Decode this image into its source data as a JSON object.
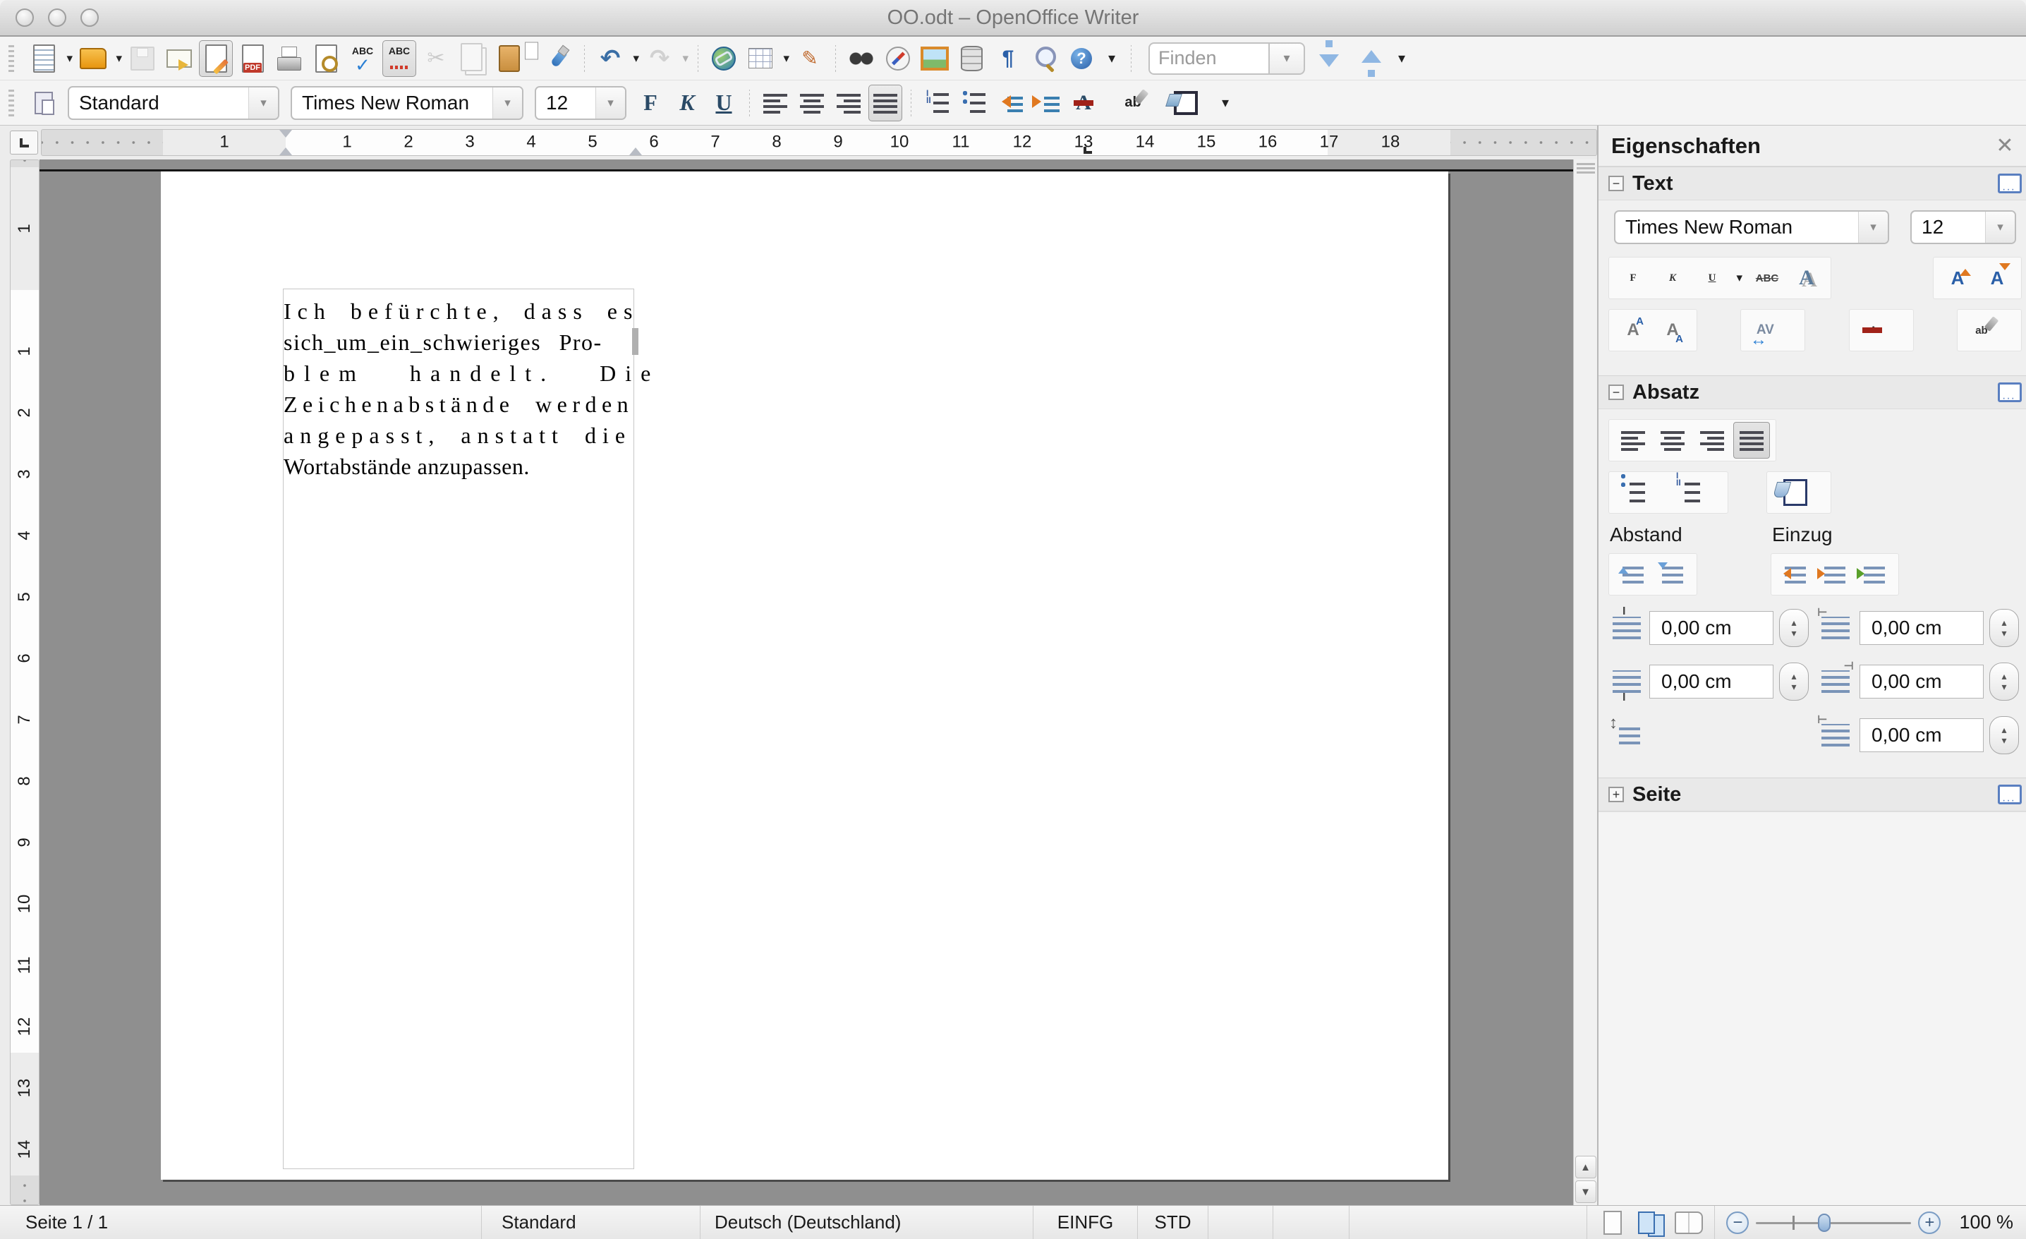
{
  "window": {
    "title": "OO.odt – OpenOffice Writer"
  },
  "toolbar_main": {
    "find_placeholder": "Finden",
    "items": [
      {
        "name": "toolbar-grip",
        "cls": "tb-grip",
        "inter": "true"
      },
      {
        "name": "new-document-icon",
        "cls": "tbtn i-new dd",
        "inter": "true"
      },
      {
        "name": "open-icon",
        "cls": "tbtn i-open dd",
        "inter": "true"
      },
      {
        "name": "save-icon",
        "cls": "tbtn i-save",
        "state": "disabled",
        "inter": "true"
      },
      {
        "name": "email-icon",
        "cls": "tbtn i-mail",
        "inter": "true"
      },
      {
        "name": "edit-file-icon",
        "cls": "tbtn i-edit",
        "state": "active",
        "inter": "true"
      },
      {
        "name": "export-pdf-icon",
        "cls": "tbtn i-pdf",
        "inter": "true"
      },
      {
        "name": "print-icon",
        "cls": "tbtn i-print",
        "inter": "true"
      },
      {
        "name": "page-preview-icon",
        "cls": "tbtn i-preview",
        "inter": "true"
      },
      {
        "name": "spellcheck-icon",
        "cls": "tbtn i-spell",
        "glyph": "ABC",
        "inter": "true"
      },
      {
        "name": "auto-spellcheck-icon",
        "cls": "tbtn i-autospell",
        "glyph": "ABC",
        "state": "active",
        "inter": "true"
      },
      {
        "name": "cut-icon",
        "cls": "tbtn i-cut",
        "glyph": "✂",
        "state": "disabled",
        "inter": "true"
      },
      {
        "name": "copy-icon",
        "cls": "tbtn i-copy",
        "state": "disabled",
        "inter": "true"
      },
      {
        "name": "paste-icon",
        "cls": "tbtn i-paste dd",
        "inter": "true"
      },
      {
        "name": "format-paintbrush-icon",
        "cls": "tbtn i-brush",
        "inter": "true"
      },
      {
        "name": "separator",
        "cls": "tb-sep",
        "inter": "false"
      },
      {
        "name": "undo-icon",
        "cls": "tbtn i-undo dd",
        "glyph": "↶",
        "inter": "true"
      },
      {
        "name": "redo-icon",
        "cls": "tbtn i-redo dd",
        "glyph": "↷",
        "state": "disabled",
        "inter": "true"
      },
      {
        "name": "separator",
        "cls": "tb-sep",
        "inter": "false"
      },
      {
        "name": "hyperlink-icon",
        "cls": "tbtn i-link",
        "inter": "true"
      },
      {
        "name": "insert-table-icon",
        "cls": "tbtn i-table dd",
        "inter": "true"
      },
      {
        "name": "draw-functions-icon",
        "cls": "tbtn i-draw",
        "glyph": "✎",
        "inter": "true"
      },
      {
        "name": "separator",
        "cls": "tb-sep",
        "inter": "false"
      },
      {
        "name": "find-replace-icon",
        "cls": "tbtn i-find",
        "inter": "true"
      },
      {
        "name": "navigator-icon",
        "cls": "tbtn i-nav",
        "inter": "true"
      },
      {
        "name": "gallery-icon",
        "cls": "tbtn i-gallery",
        "inter": "true"
      },
      {
        "name": "data-sources-icon",
        "cls": "tbtn i-data",
        "inter": "true"
      },
      {
        "name": "nonprinting-characters-icon",
        "cls": "tbtn i-pilcrow",
        "glyph": "¶",
        "inter": "true"
      },
      {
        "name": "zoom-icon",
        "cls": "tbtn i-zoom",
        "inter": "true"
      },
      {
        "name": "help-icon",
        "cls": "tbtn i-help",
        "glyph": "?",
        "inter": "true"
      },
      {
        "name": "toolbar-overflow-icon",
        "cls": "tbtn i-ovf",
        "glyph": "▾",
        "inter": "true"
      }
    ]
  },
  "toolbar_format": {
    "style_value": "Standard",
    "font_value": "Times New Roman",
    "size_value": "12",
    "dd_glyph": "▾",
    "items": [
      {
        "name": "bold-icon",
        "cls": "tbtn i-bold",
        "glyph": "F",
        "inter": "true"
      },
      {
        "name": "italic-icon",
        "cls": "tbtn i-italic",
        "glyph": "K",
        "inter": "true"
      },
      {
        "name": "underline-icon",
        "cls": "tbtn i-underline",
        "glyph": "U",
        "inter": "true"
      },
      {
        "name": "separator",
        "cls": "tb-sep",
        "inter": "false"
      },
      {
        "name": "align-left-icon",
        "cls": "tbtn al al-l",
        "inter": "true"
      },
      {
        "name": "align-center-icon",
        "cls": "tbtn al al-c",
        "inter": "true"
      },
      {
        "name": "align-right-icon",
        "cls": "tbtn al al-r",
        "inter": "true"
      },
      {
        "name": "align-justify-icon",
        "cls": "tbtn al al-j",
        "state": "active",
        "inter": "true"
      },
      {
        "name": "separator",
        "cls": "tb-sep",
        "inter": "false"
      },
      {
        "name": "numbered-list-icon",
        "cls": "tbtn i-listnum",
        "inter": "true"
      },
      {
        "name": "bullet-list-icon",
        "cls": "tbtn i-listbul",
        "inter": "true"
      },
      {
        "name": "decrease-indent-icon",
        "cls": "tbtn i-outdent",
        "inter": "true"
      },
      {
        "name": "increase-indent-icon",
        "cls": "tbtn i-indent",
        "inter": "true"
      },
      {
        "name": "font-color-icon",
        "cls": "tbtn i-fontcolor dd",
        "glyph": "A",
        "inter": "true"
      },
      {
        "name": "highlighting-icon",
        "cls": "tbtn i-highlight dd",
        "glyph": "ab",
        "inter": "true"
      },
      {
        "name": "background-color-icon",
        "cls": "tbtn i-bgcolor dd",
        "inter": "true"
      },
      {
        "name": "toolbar-overflow-icon",
        "cls": "tbtn i-ovf",
        "glyph": "▾",
        "inter": "true"
      }
    ]
  },
  "ruler": {
    "h_numbers": [
      {
        "n": "1",
        "style": "left:259px",
        "inter": "false"
      },
      {
        "n": "1",
        "style": "left:433px",
        "inter": "false"
      },
      {
        "n": "2",
        "style": "left:520px",
        "inter": "false"
      },
      {
        "n": "3",
        "style": "left:607px",
        "inter": "false"
      },
      {
        "n": "4",
        "style": "left:694px",
        "inter": "false"
      },
      {
        "n": "5",
        "style": "left:781px",
        "inter": "false"
      },
      {
        "n": "6",
        "style": "left:868px",
        "inter": "false"
      },
      {
        "n": "7",
        "style": "left:955px",
        "inter": "false"
      },
      {
        "n": "8",
        "style": "left:1042px",
        "inter": "false"
      },
      {
        "n": "9",
        "style": "left:1129px",
        "inter": "false"
      },
      {
        "n": "10",
        "style": "left:1216px",
        "inter": "false"
      },
      {
        "n": "11",
        "style": "left:1303px",
        "inter": "false"
      },
      {
        "n": "12",
        "style": "left:1390px",
        "inter": "false"
      },
      {
        "n": "13",
        "style": "left:1477px",
        "inter": "false"
      },
      {
        "n": "14",
        "style": "left:1564px",
        "inter": "false"
      },
      {
        "n": "15",
        "style": "left:1651px",
        "inter": "false"
      },
      {
        "n": "16",
        "style": "left:1738px",
        "inter": "false"
      },
      {
        "n": "17",
        "style": "left:1825px",
        "inter": "false"
      },
      {
        "n": "18",
        "style": "left:1912px",
        "inter": "false"
      }
    ],
    "v_numbers": [
      {
        "n": "1",
        "style": "top:97px",
        "inter": "false"
      },
      {
        "n": "1",
        "style": "top:271px",
        "inter": "false"
      },
      {
        "n": "2",
        "style": "top:358px",
        "inter": "false"
      },
      {
        "n": "3",
        "style": "top:445px",
        "inter": "false"
      },
      {
        "n": "4",
        "style": "top:532px",
        "inter": "false"
      },
      {
        "n": "5",
        "style": "top:619px",
        "inter": "false"
      },
      {
        "n": "6",
        "style": "top:706px",
        "inter": "false"
      },
      {
        "n": "7",
        "style": "top:793px",
        "inter": "false"
      },
      {
        "n": "8",
        "style": "top:880px",
        "inter": "false"
      },
      {
        "n": "9",
        "style": "top:967px",
        "inter": "false"
      },
      {
        "n": "10",
        "style": "top:1054px",
        "inter": "false"
      },
      {
        "n": "11",
        "style": "top:1141px",
        "inter": "false"
      },
      {
        "n": "12",
        "style": "top:1228px",
        "inter": "false"
      },
      {
        "n": "13",
        "style": "top:1315px",
        "inter": "false"
      },
      {
        "n": "14",
        "style": "top:1402px",
        "inter": "false"
      }
    ]
  },
  "document": {
    "lines": [
      "Ich befürchte, dass es",
      "sich_um_ein_schwieriges Pro-",
      "blem handelt. Die",
      "Zeichenabstände werden",
      "angepasst, anstatt die",
      "Wortabstände anzupassen."
    ]
  },
  "sidebar": {
    "title": "Eigenschaften",
    "close_glyph": "✕",
    "text_section": {
      "label": "Text",
      "collapse_glyph": "−",
      "font_value": "Times New Roman",
      "size_value": "12",
      "dd_glyph": "▾",
      "row1": [
        {
          "name": "bold-icon",
          "cls": "sbtn i-bold",
          "glyph": "F",
          "inter": "true"
        },
        {
          "name": "italic-icon",
          "cls": "sbtn i-italic",
          "glyph": "K",
          "inter": "true"
        },
        {
          "name": "underline-icon",
          "cls": "sbtn i-underline dd",
          "glyph": "U",
          "inter": "true"
        },
        {
          "name": "strikethrough-icon",
          "cls": "sbtn i-strike",
          "glyph": "ABC",
          "inter": "true"
        },
        {
          "name": "text-shadow-icon",
          "cls": "sbtn i-shadow",
          "glyph": "A",
          "inter": "true"
        }
      ],
      "row1b": [
        {
          "name": "increase-font-size-icon",
          "cls": "sbtn i-sizeup",
          "inter": "true"
        },
        {
          "name": "decrease-font-size-icon",
          "cls": "sbtn i-sizedown",
          "inter": "true"
        }
      ],
      "row2a": [
        {
          "name": "superscript-icon",
          "cls": "sbtn i-sup",
          "inter": "true"
        },
        {
          "name": "subscript-icon",
          "cls": "sbtn i-sub",
          "inter": "true"
        }
      ],
      "row2b": [
        {
          "name": "character-spacing-icon",
          "cls": "sbtn i-charsp dd",
          "glyph": "AV",
          "inter": "true"
        }
      ],
      "row2c": [
        {
          "name": "font-color-icon",
          "cls": "sbtn i-fontcolor dd",
          "glyph": "A",
          "inter": "true"
        }
      ],
      "row2d": [
        {
          "name": "highlighting-icon",
          "cls": "sbtn i-highlight dd",
          "glyph": "ab",
          "inter": "true"
        }
      ]
    },
    "absatz_section": {
      "label": "Absatz",
      "collapse_glyph": "−",
      "align_row": [
        {
          "name": "align-left-icon",
          "cls": "sbtn al al-l",
          "inter": "true"
        },
        {
          "name": "align-center-icon",
          "cls": "sbtn al al-c",
          "inter": "true"
        },
        {
          "name": "align-right-icon",
          "cls": "sbtn al al-r",
          "inter": "true"
        },
        {
          "name": "align-justify-icon",
          "cls": "sbtn al al-j",
          "state": "active",
          "inter": "true"
        }
      ],
      "list_row": [
        {
          "name": "bullet-list-icon",
          "cls": "sbtn i-listbul dd",
          "inter": "true"
        },
        {
          "name": "numbered-list-icon",
          "cls": "sbtn i-listnum dd",
          "inter": "true"
        }
      ],
      "bg_row": [
        {
          "name": "paragraph-background-icon",
          "cls": "sbtn i-parabg dd",
          "inter": "true"
        }
      ],
      "abstand_label": "Abstand",
      "einzug_label": "Einzug",
      "abstand_row": [
        {
          "name": "increase-paragraph-spacing-icon",
          "cls": "sbtn barsic i-spinc",
          "inter": "true"
        },
        {
          "name": "decrease-paragraph-spacing-icon",
          "cls": "sbtn barsic i-spdec",
          "inter": "true"
        }
      ],
      "einzug_row": [
        {
          "name": "increase-indent-icon",
          "cls": "sbtn barsic i-einzinc",
          "inter": "true"
        },
        {
          "name": "decrease-indent-icon",
          "cls": "sbtn barsic i-einzdec",
          "inter": "true"
        },
        {
          "name": "switch-hanging-indent-icon",
          "cls": "sbtn barsic i-einzsw",
          "inter": "true"
        }
      ],
      "fields": {
        "above": "0,00 cm",
        "below": "0,00 cm",
        "before": "0,00 cm",
        "after": "0,00 cm",
        "first_line": "0,00 cm"
      },
      "spin_up": "▴",
      "spin_down": "▾"
    },
    "seite_section": {
      "label": "Seite",
      "collapse_glyph": "+"
    },
    "tabs": [
      {
        "name": "sidebar-menu-icon",
        "cls": "stab t-menu",
        "glyph": "≡",
        "inter": "true"
      },
      {
        "name": "properties-tab-icon",
        "cls": "stab t-props",
        "state": "active",
        "inter": "true"
      },
      {
        "name": "styles-tab-icon",
        "cls": "stab t-styles",
        "inter": "true"
      },
      {
        "name": "gallery-tab-icon",
        "cls": "stab t-gallery",
        "inter": "true"
      },
      {
        "name": "navigator-tab-icon",
        "cls": "stab t-nav",
        "inter": "true"
      }
    ]
  },
  "statusbar": {
    "page": "Seite 1 / 1",
    "style": "Standard",
    "language": "Deutsch (Deutschland)",
    "insert_mode": "EINFG",
    "selection_mode": "STD",
    "zoom_level": "100 %",
    "zoom_out_glyph": "−",
    "zoom_in_glyph": "+"
  },
  "scrollbar": {
    "up_glyph": "▲",
    "down_glyph": "▼"
  },
  "colors": {
    "accent_blue": "#2a7fd4",
    "font_color_red": "#a02219",
    "highlight_yellow": "#f6e13d"
  }
}
